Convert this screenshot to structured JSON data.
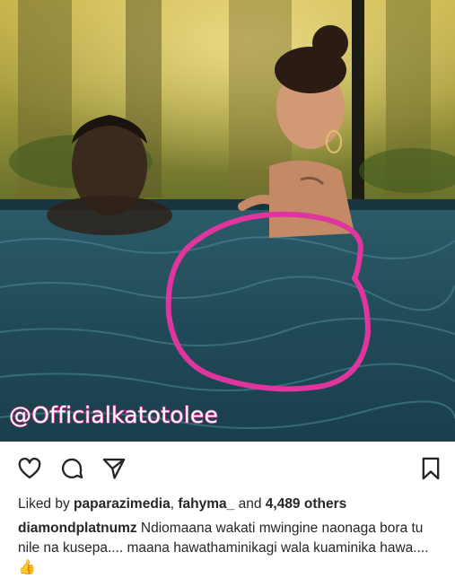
{
  "photo": {
    "alt": "",
    "watermark": "@Officialkatotolee"
  },
  "actions": {
    "like_icon": "heart-icon",
    "comment_icon": "comment-icon",
    "share_icon": "send-icon",
    "save_icon": "bookmark-icon"
  },
  "likes": {
    "prefix": "Liked by",
    "user1": "paparazimedia",
    "separator": ",",
    "user2": "fahyma_",
    "and": "and",
    "count": "4,489 others"
  },
  "caption": {
    "username": "diamondplatnumz",
    "text": "Ndiomaana wakati mwingine naonaga bora tu nile na kusepa.... maana hawathaminikagi wala kuaminika hawa....",
    "emoji": "👍"
  },
  "colors": {
    "circle": "#e0359e",
    "text": "#262626",
    "water": "#1f4d5e"
  }
}
